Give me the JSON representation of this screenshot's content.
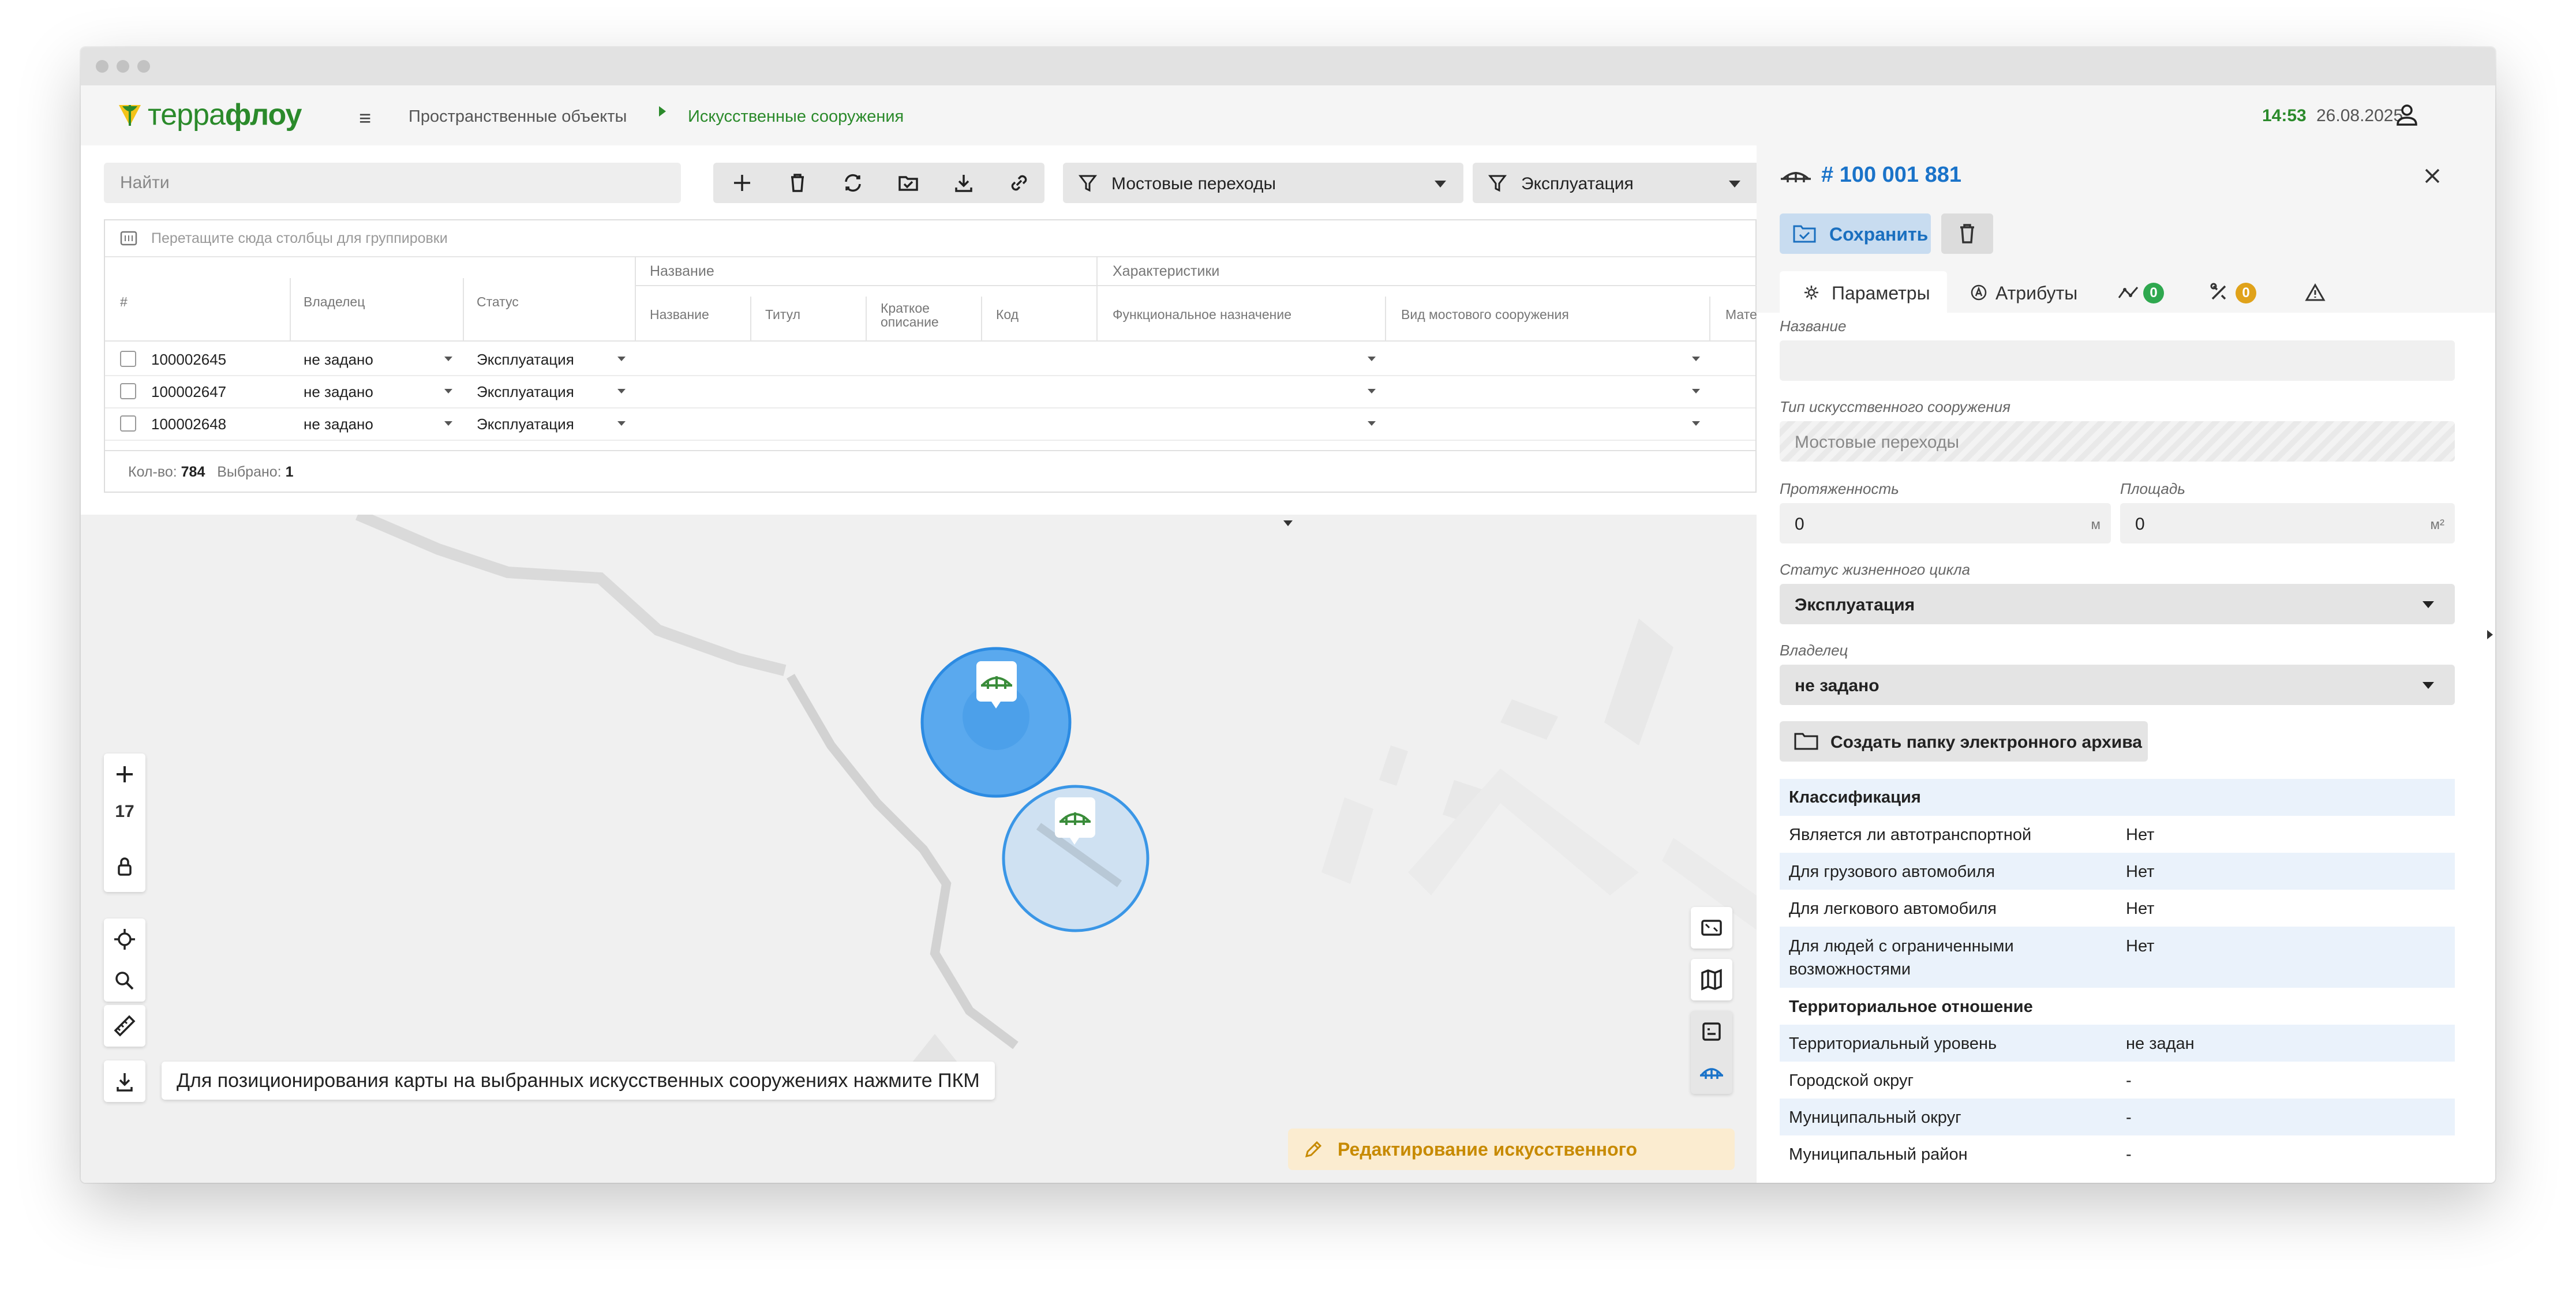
{
  "header": {
    "logo_part1": "терра",
    "logo_part2": "флоу",
    "breadcrumb": [
      "Пространственные объекты",
      "Искусственные сооружения"
    ],
    "time": "14:53",
    "date": "26.08.2025"
  },
  "toolbar": {
    "search_placeholder": "Найти",
    "filter1": "Мостовые переходы",
    "filter2": "Эксплуатация"
  },
  "table": {
    "group_hint": "Перетащите сюда столбцы для группировки",
    "headers": {
      "num": "#",
      "owner": "Владелец",
      "status": "Статус",
      "name_group": "Название",
      "char_group": "Характеристики",
      "name": "Название",
      "titul": "Титул",
      "short_desc": "Краткое описание",
      "code": "Код",
      "func": "Функциональное назначение",
      "bridge_type": "Вид мостового сооружения",
      "material": "Матер"
    },
    "rows": [
      {
        "id": "100002645",
        "owner": "не задано",
        "status": "Эксплуатация"
      },
      {
        "id": "100002647",
        "owner": "не задано",
        "status": "Эксплуатация"
      },
      {
        "id": "100002648",
        "owner": "не задано",
        "status": "Эксплуатация"
      }
    ],
    "footer": {
      "count_label": "Кол-во:",
      "count": "784",
      "selected_label": "Выбрано:",
      "selected": "1"
    }
  },
  "map": {
    "zoom_level": "17",
    "hint": "Для позиционирования карты на выбранных искусственных сооружениях нажмите ПКМ",
    "edit_badge": "Редактирование искусственного сооружения"
  },
  "panel": {
    "object_id": "# 100 001 881",
    "save_label": "Сохранить",
    "tabs": {
      "params": "Параметры",
      "attrs": "Атрибуты",
      "badge1": "0",
      "badge2": "0"
    },
    "fields": {
      "name_label": "Название",
      "name_value": "",
      "type_label": "Тип искусственного сооружения",
      "type_value": "Мостовые переходы",
      "length_label": "Протяженность",
      "length_value": "0",
      "length_unit": "м",
      "area_label": "Площадь",
      "area_value": "0",
      "area_unit": "м²",
      "status_label": "Статус жизненного цикла",
      "status_value": "Эксплуатация",
      "owner_label": "Владелец",
      "owner_value": "не задано"
    },
    "archive_button": "Создать папку электронного архива",
    "classification": {
      "title": "Классификация",
      "rows": [
        {
          "k": "Является ли автотранспортной",
          "v": "Нет"
        },
        {
          "k": "Для грузового автомобиля",
          "v": "Нет"
        },
        {
          "k": "Для легкового автомобиля",
          "v": "Нет"
        },
        {
          "k1": "Для людей с ограниченными",
          "k2": "возможностями",
          "v": "Нет"
        }
      ]
    },
    "territorial": {
      "title": "Территориальное отношение",
      "rows": [
        {
          "k": "Территориальный уровень",
          "v": "не задан"
        },
        {
          "k": "Городской округ",
          "v": "-"
        },
        {
          "k": "Муниципальный округ",
          "v": "-"
        },
        {
          "k": "Муниципальный район",
          "v": "-"
        }
      ]
    }
  },
  "colors": {
    "brand": "#2b8a2b",
    "accent": "#1a73c9",
    "warning": "#c78a00",
    "badge_green": "#2fa84f",
    "badge_orange": "#e0a21a"
  }
}
